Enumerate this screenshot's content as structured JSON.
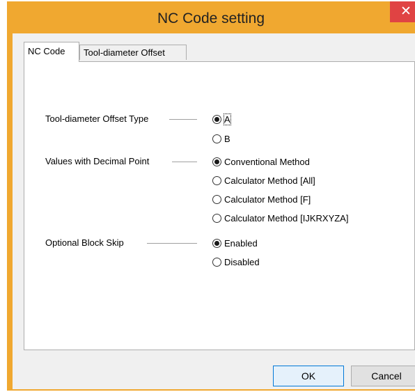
{
  "window": {
    "title": "NC Code setting",
    "close_glyph": "✕",
    "accent_color": "#f0a830",
    "close_color": "#e04343"
  },
  "tabs": [
    {
      "label": "NC Code",
      "selected": true
    },
    {
      "label": "Tool-diameter Offset",
      "selected": false
    }
  ],
  "groups": [
    {
      "label": "Tool-diameter Offset Type",
      "options": [
        {
          "label": "A",
          "checked": true
        },
        {
          "label": "B",
          "checked": false
        }
      ]
    },
    {
      "label": "Values with Decimal Point",
      "options": [
        {
          "label": "Conventional Method",
          "checked": true
        },
        {
          "label": "Calculator Method [All]",
          "checked": false
        },
        {
          "label": "Calculator Method [F]",
          "checked": false
        },
        {
          "label": "Calculator Method [IJKRXYZA]",
          "checked": false
        }
      ]
    },
    {
      "label": "Optional Block Skip",
      "options": [
        {
          "label": "Enabled",
          "checked": true
        },
        {
          "label": "Disabled",
          "checked": false
        }
      ]
    }
  ],
  "buttons": {
    "ok_label": "OK",
    "cancel_label": "Cancel"
  }
}
